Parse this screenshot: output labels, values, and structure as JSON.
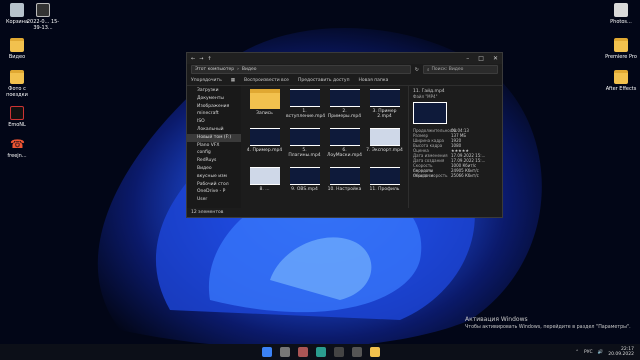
{
  "desktop": {
    "left_icons": [
      {
        "label": "Корзина",
        "icon": "recycle-bin-icon"
      },
      {
        "label": "2022-0... 15-39-13...",
        "icon": "image-file-icon"
      },
      {
        "label": "Видео",
        "icon": "folder-icon"
      },
      {
        "label": "Фото с поездки",
        "icon": "folder-icon"
      },
      {
        "label": "EmoNL",
        "icon": "app-icon"
      },
      {
        "label": "freejn...",
        "icon": "red-app-icon"
      }
    ],
    "right_icons": [
      {
        "label": "Photos...",
        "icon": "doc-icon"
      },
      {
        "label": "Premiere Pro",
        "icon": "premiere-icon"
      },
      {
        "label": "After Effects",
        "icon": "after-effects-icon"
      }
    ]
  },
  "explorer": {
    "breadcrumb_root": "Этот компьютер",
    "breadcrumb_leaf": "Видео",
    "search_placeholder": "Поиск: Видео",
    "toolbar": [
      "Упорядочить",
      "Воспроизвести все",
      "Предоставить доступ",
      "Новая папка"
    ],
    "nav": [
      "Загрузки",
      "Документы",
      "Изображения",
      "minecraft",
      "ISO",
      "Локальный",
      "Новый том (F:)",
      "Plano VFX",
      "config",
      "RedRuys",
      "Видео",
      "вкусные изм",
      "Рабочий стол",
      "OneDrive - P",
      "User"
    ],
    "nav_selected_index": 6,
    "files": [
      {
        "name": "Запись",
        "kind": "folder"
      },
      {
        "name": "1. вступление.mp4",
        "kind": "video"
      },
      {
        "name": "2. Примеры.mp4",
        "kind": "video"
      },
      {
        "name": "3. Пример 2.mp4",
        "kind": "video"
      },
      {
        "name": "4. Пример.mp4",
        "kind": "video"
      },
      {
        "name": "5. Плагины.mp4",
        "kind": "video"
      },
      {
        "name": "6. ЛоуМаски.mp4",
        "kind": "video"
      },
      {
        "name": "7. Экспорт.mp4",
        "kind": "video-light"
      },
      {
        "name": "8. ...",
        "kind": "video-light"
      },
      {
        "name": "9. OBS.mp4",
        "kind": "video"
      },
      {
        "name": "10. Настройка",
        "kind": "video"
      },
      {
        "name": "11. Профиль",
        "kind": "video"
      }
    ],
    "details": {
      "title": "11. Гайд.mp4",
      "subtitle": "Файл \"MP4\"",
      "props": [
        {
          "k": "Продолжительность",
          "v": "00:04:13"
        },
        {
          "k": "Размер",
          "v": "137 МБ"
        },
        {
          "k": "Ширина кадра",
          "v": "1920"
        },
        {
          "k": "Высота кадра",
          "v": "1080"
        },
        {
          "k": "Оценка",
          "v": "★★★★★"
        },
        {
          "k": "Дата изменения",
          "v": "17.09.2022 15:..."
        },
        {
          "k": "Дата создания",
          "v": "17.09.2022 15:..."
        },
        {
          "k": "Скорость передачи",
          "v": "1000 Кбит/с"
        },
        {
          "k": "Скорость передачи",
          "v": "24905 Кбит/с"
        },
        {
          "k": "Общая скорость",
          "v": "25066 Кбит/с"
        }
      ]
    },
    "status": "12 элементов"
  },
  "activation": {
    "line1": "Активация Windows",
    "line2": "Чтобы активировать Windows, перейдите в раздел \"Параметры\"."
  },
  "tray": {
    "lang": "РУС",
    "time": "22:17",
    "date": "20.09.2022"
  },
  "colors": {
    "accent": "#1f5bff",
    "taskbar": "#0c0f18"
  }
}
